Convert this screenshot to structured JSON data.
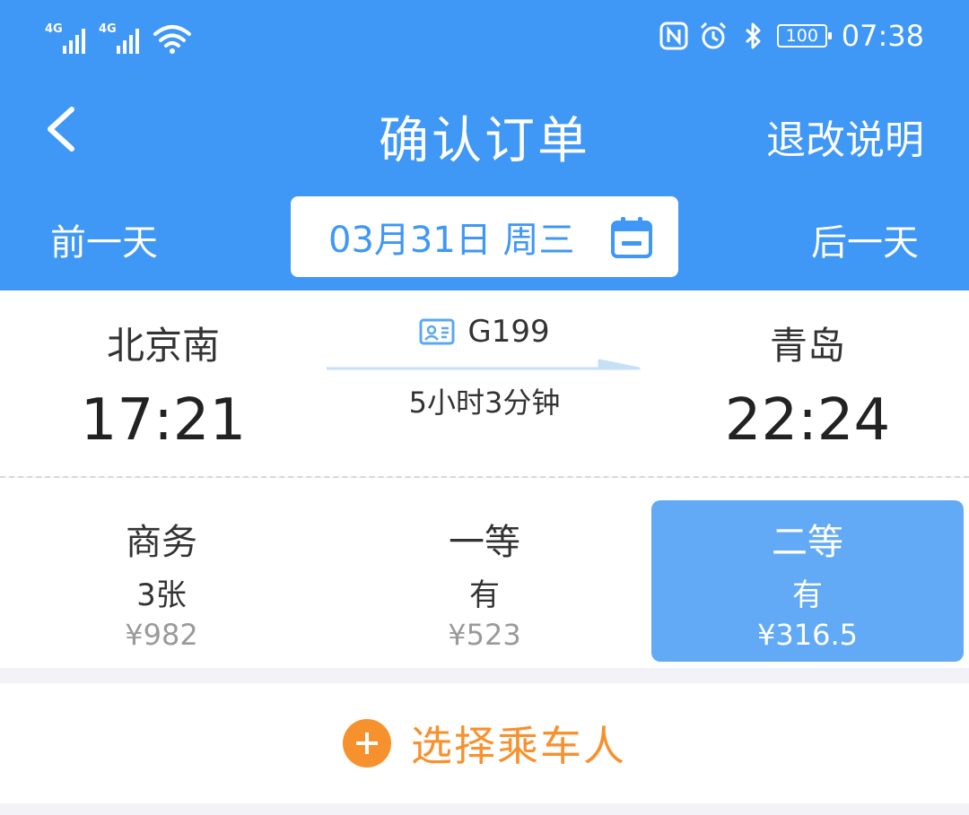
{
  "status_bar": {
    "signal1_label": "4G",
    "signal2_label": "4G",
    "battery": "100",
    "time": "07:38"
  },
  "nav": {
    "title": "确认订单",
    "refund_label": "退改说明",
    "prev_day": "前一天",
    "next_day": "后一天",
    "date": "03月31日 周三"
  },
  "train": {
    "from_station": "北京南",
    "to_station": "青岛",
    "number": "G199",
    "depart_time": "17:21",
    "arrive_time": "22:24",
    "duration": "5小时3分钟"
  },
  "seats": [
    {
      "class": "商务",
      "availability": "3张",
      "price": "¥982"
    },
    {
      "class": "一等",
      "availability": "有",
      "price": "¥523"
    },
    {
      "class": "二等",
      "availability": "有",
      "price": "¥316.5"
    }
  ],
  "passenger": {
    "add_label": "选择乘车人"
  },
  "colors": {
    "primary": "#3f97f6",
    "selected_seat": "#62aaf6",
    "accent_orange": "#f7912e"
  }
}
